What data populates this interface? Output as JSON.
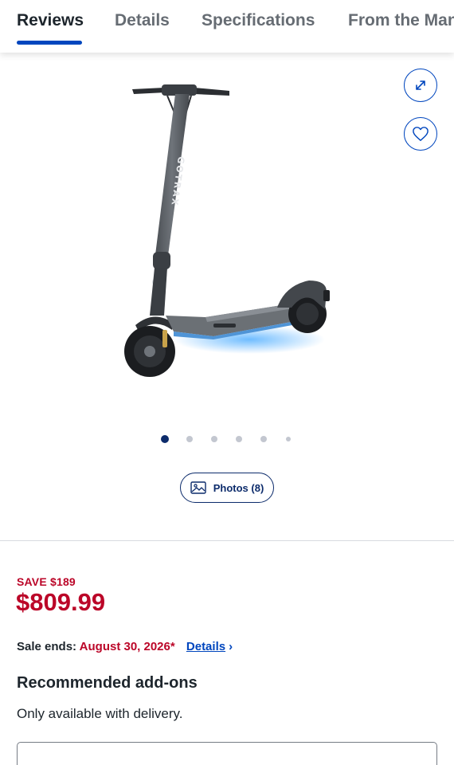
{
  "tabs": [
    {
      "label": "Reviews",
      "active": true
    },
    {
      "label": "Details",
      "active": false
    },
    {
      "label": "Specifications",
      "active": false
    },
    {
      "label": "From the Manufacturer",
      "active": false
    }
  ],
  "gallery": {
    "expand_icon": "expand-arrows-icon",
    "favorite_icon": "heart-icon",
    "image_count": 6,
    "active_index": 0,
    "photos_button_label": "Photos (8)",
    "photos_icon": "image-icon"
  },
  "pricing": {
    "save_label": "SAVE $189",
    "price": "$809.99",
    "sale_ends_label": "Sale ends:",
    "sale_ends_date": "August 30, 2026*",
    "details_link": "Details"
  },
  "addons": {
    "title": "Recommended add-ons",
    "subtitle": "Only available with delivery."
  },
  "colors": {
    "accent_blue": "#0046be",
    "sale_red": "#bb0628",
    "dark_navy": "#0c2b6b"
  }
}
